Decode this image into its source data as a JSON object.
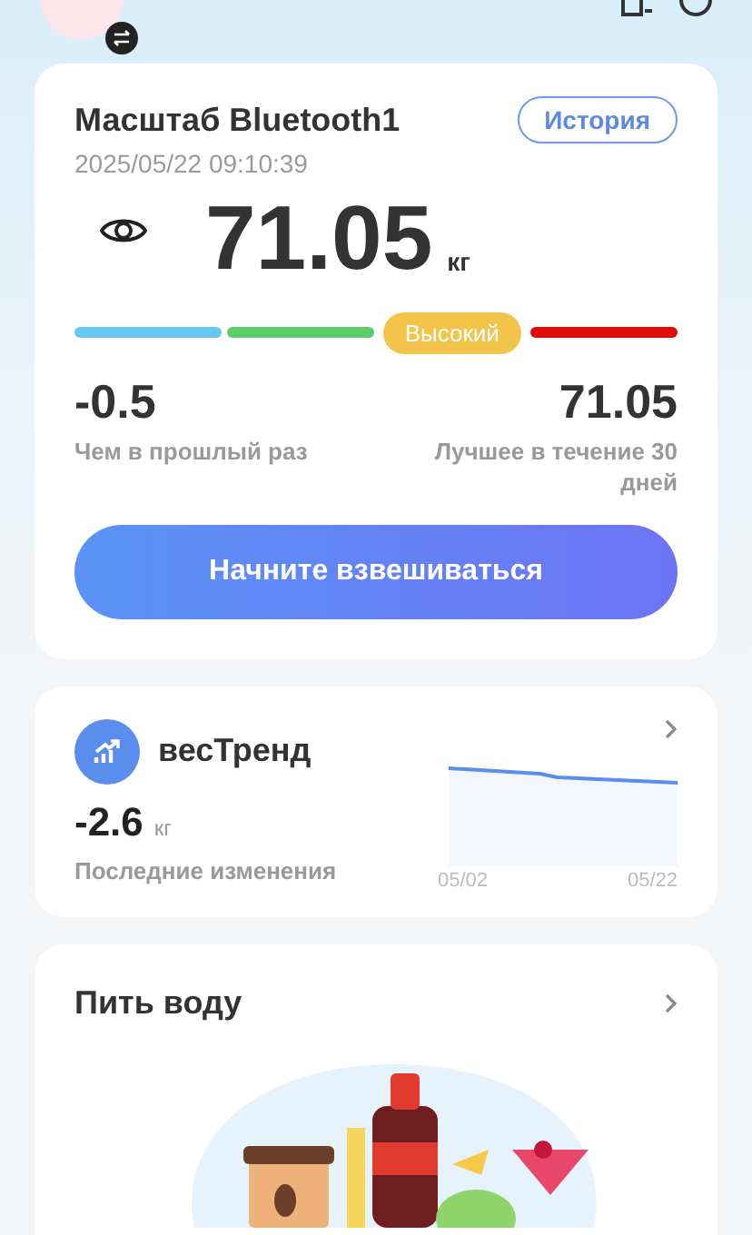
{
  "weight_card": {
    "title": "Масштаб Bluetooth1",
    "history_button": "История",
    "timestamp": "2025/05/22 09:10:39",
    "weight": "71.05",
    "unit": "кг",
    "scale": [
      {
        "color": "#66c8f0",
        "selected": false
      },
      {
        "color": "#5dcb6a",
        "selected": false
      },
      {
        "color": "#f3c44a",
        "selected": true,
        "label": "Высокий"
      },
      {
        "color": "#e00c0c",
        "selected": false
      }
    ],
    "stats": [
      {
        "value": "-0.5",
        "label": "Чем в прошлый раз"
      },
      {
        "value": "71.05",
        "label": "Лучшее в течение 30 дней"
      }
    ],
    "start_button": "Начните взвешиваться"
  },
  "trend_card": {
    "title": "весТренд",
    "change": "-2.6",
    "unit": "кг",
    "caption": "Последние изменения",
    "x_labels": [
      "05/02",
      "05/22"
    ]
  },
  "water_card": {
    "title": "Пить воду"
  }
}
